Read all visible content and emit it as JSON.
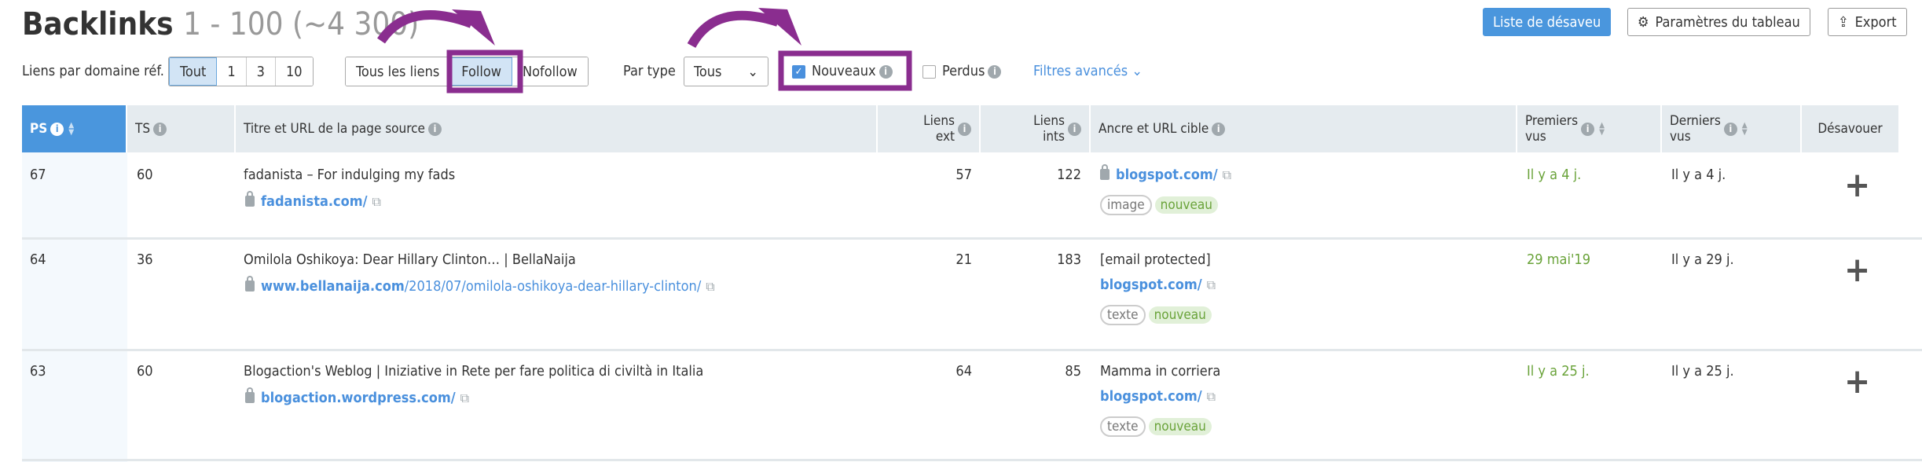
{
  "header": {
    "title": "Backlinks",
    "range": "1 - 100 (~4 300)",
    "buttons": {
      "disavow_list": "Liste de désaveu",
      "table_settings": "Paramètres du tableau",
      "export": "Export"
    }
  },
  "filters": {
    "per_domain_label": "Liens par domaine réf.",
    "per_domain_options": [
      "Tout",
      "1",
      "3",
      "10"
    ],
    "per_domain_selected": "Tout",
    "link_type_options": [
      "Tous les liens",
      "Follow",
      "Nofollow"
    ],
    "link_type_selected": "Follow",
    "par_type_label": "Par type",
    "par_type_value": "Tous",
    "nouveaux_label": "Nouveaux",
    "nouveaux_checked": true,
    "perdus_label": "Perdus",
    "perdus_checked": false,
    "advanced": "Filtres avancés"
  },
  "table": {
    "columns": {
      "ps": "PS",
      "ts": "TS",
      "title": "Titre et URL de la page source",
      "ext_1": "Liens",
      "ext_2": "ext",
      "ints_1": "Liens",
      "ints_2": "ints",
      "anchor": "Ancre et URL cible",
      "first_1": "Premiers",
      "first_2": "vus",
      "last_1": "Derniers",
      "last_2": "vus",
      "disavow": "Désavouer"
    },
    "rows": [
      {
        "ps": "67",
        "ts": "60",
        "title": "fadanista – For indulging my fads",
        "url_domain": "fadanista.com/",
        "url_path": "",
        "ext": "57",
        "ints": "122",
        "anchor": "",
        "target": "blogspot.com/",
        "target_secure": true,
        "tags": [
          "image",
          "nouveau"
        ],
        "first_seen": "Il y a 4 j.",
        "last_seen": "Il y a 4 j."
      },
      {
        "ps": "64",
        "ts": "36",
        "title": "Omilola Oshikoya: Dear Hillary Clinton… | BellaNaija",
        "url_domain": "www.bellanaija.com",
        "url_path": "/2018/07/omilola-oshikoya-dear-hillary-clinton/",
        "ext": "21",
        "ints": "183",
        "anchor": "[email protected]",
        "target": "blogspot.com/",
        "target_secure": false,
        "tags": [
          "texte",
          "nouveau"
        ],
        "first_seen": "29 mai'19",
        "last_seen": "Il y a 29 j."
      },
      {
        "ps": "63",
        "ts": "60",
        "title": "Blogaction's Weblog | Iniziative in Rete per fare politica di civiltà in Italia",
        "url_domain": "blogaction.wordpress.com/",
        "url_path": "",
        "ext": "64",
        "ints": "85",
        "anchor": "Mamma in corriera",
        "target": "blogspot.com/",
        "target_secure": false,
        "tags": [
          "texte",
          "nouveau"
        ],
        "first_seen": "Il y a 25 j.",
        "last_seen": "Il y a 25 j."
      }
    ]
  },
  "colors": {
    "accent": "#4a96dd",
    "highlight_annotation": "#8a2d8f",
    "new_green": "#6aa33a"
  }
}
